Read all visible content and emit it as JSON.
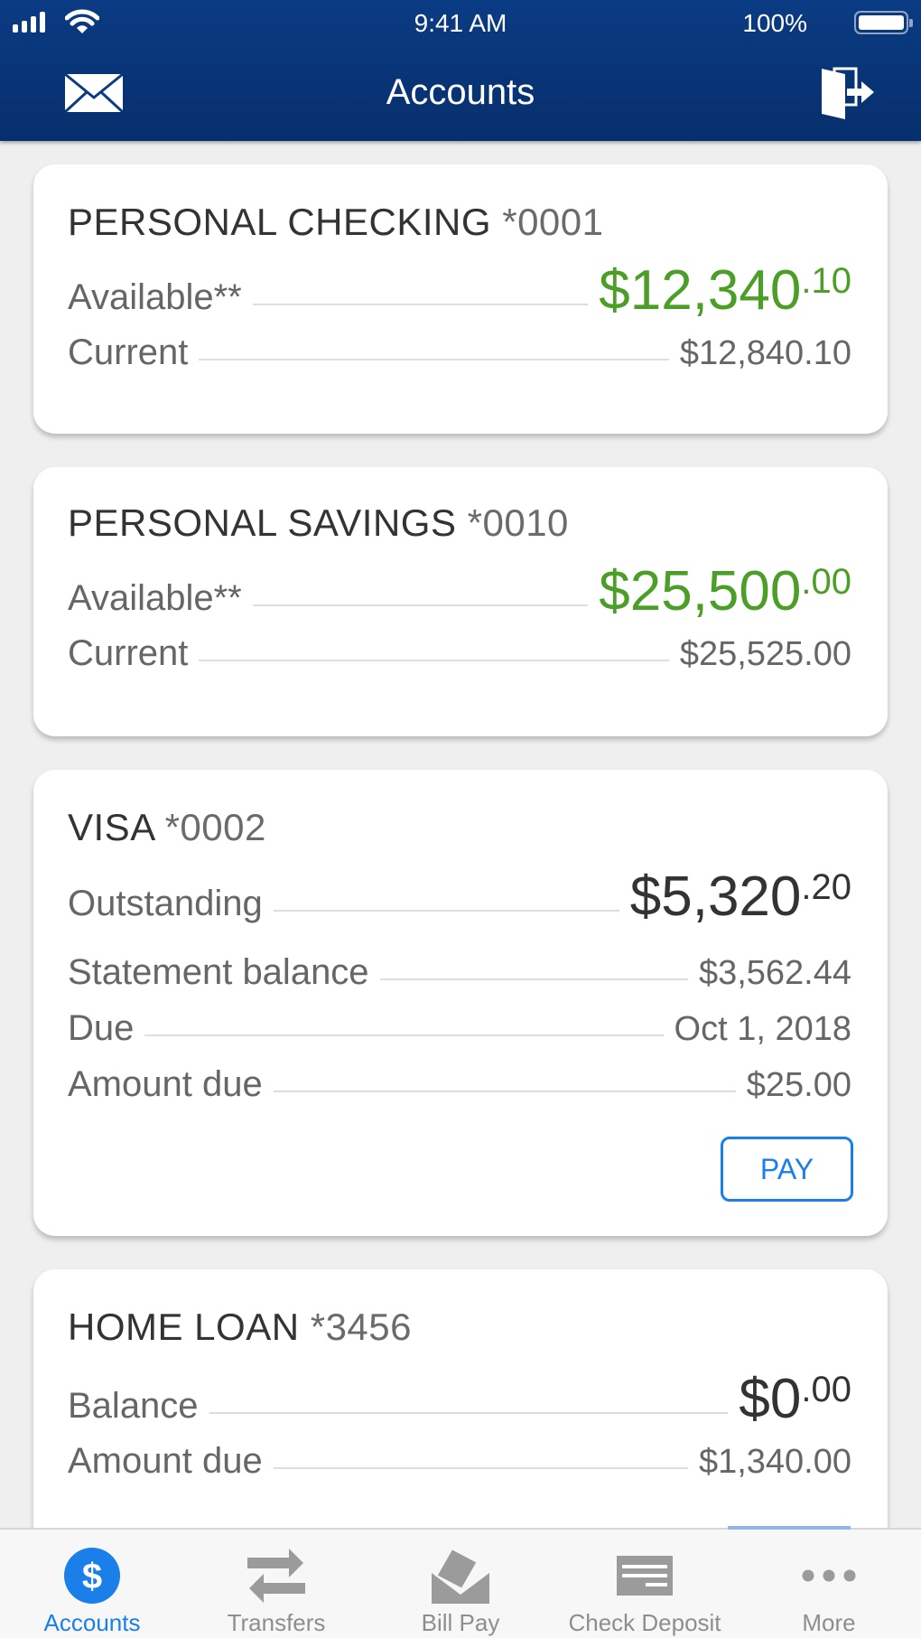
{
  "status_bar": {
    "time": "9:41 AM",
    "battery_percent": "100%",
    "battery_level": 1.0,
    "signal_bars": 4,
    "icons": [
      "signal-icon",
      "wifi-icon",
      "battery-icon"
    ]
  },
  "header": {
    "title": "Accounts",
    "left_icon": "mail-icon",
    "right_icon": "logout-icon"
  },
  "colors": {
    "header_bg": "#0a3b83",
    "positive_green": "#4b9e26",
    "accent_blue": "#1a7fe8",
    "page_bg": "#efefef"
  },
  "accounts": [
    {
      "name": "PERSONAL CHECKING",
      "number": "*0001",
      "rows": [
        {
          "label": "Available**",
          "amount_whole": "$12,340",
          "amount_cents": ".10",
          "style": "big-green"
        },
        {
          "label": "Current",
          "value": "$12,840.10"
        }
      ]
    },
    {
      "name": "PERSONAL SAVINGS",
      "number": "*0010",
      "rows": [
        {
          "label": "Available**",
          "amount_whole": "$25,500",
          "amount_cents": ".00",
          "style": "big-green"
        },
        {
          "label": "Current",
          "value": "$25,525.00"
        }
      ]
    },
    {
      "name": "VISA",
      "number": "*0002",
      "rows": [
        {
          "label": "Outstanding",
          "amount_whole": "$5,320",
          "amount_cents": ".20",
          "style": "big-dark"
        },
        {
          "label": "Statement balance",
          "value": "$3,562.44"
        },
        {
          "label": "Due",
          "value": "Oct 1, 2018"
        },
        {
          "label": "Amount due",
          "value": "$25.00"
        }
      ],
      "button": "PAY"
    },
    {
      "name": "HOME LOAN",
      "number": "*3456",
      "rows": [
        {
          "label": "Balance",
          "amount_whole": "$0",
          "amount_cents": ".00",
          "style": "big-dark"
        },
        {
          "label": "Amount due",
          "value": "$1,340.00"
        }
      ]
    }
  ],
  "tabbar": {
    "items": [
      {
        "label": "Accounts",
        "icon": "dollar-icon",
        "active": true
      },
      {
        "label": "Transfers",
        "icon": "transfer-arrows-icon",
        "active": false
      },
      {
        "label": "Bill Pay",
        "icon": "bill-pay-envelope-icon",
        "active": false
      },
      {
        "label": "Check Deposit",
        "icon": "check-icon",
        "active": false
      },
      {
        "label": "More",
        "icon": "more-dots-icon",
        "active": false
      }
    ]
  }
}
